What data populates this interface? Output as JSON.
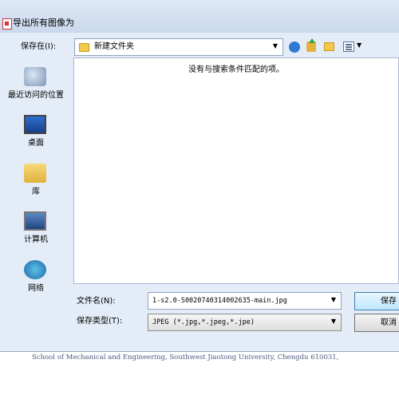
{
  "window": {
    "title": "导出所有图像为"
  },
  "toolbar": {
    "look_in_label": "保存在(I):",
    "look_in_value": "新建文件夹"
  },
  "places": [
    {
      "label": "最近访问的位置",
      "icon": "recent-places-icon"
    },
    {
      "label": "桌面",
      "icon": "desktop-icon"
    },
    {
      "label": "库",
      "icon": "library-icon"
    },
    {
      "label": "计算机",
      "icon": "computer-icon"
    },
    {
      "label": "网络",
      "icon": "network-icon"
    }
  ],
  "file_list": {
    "empty_message": "没有与搜索条件匹配的项。"
  },
  "form": {
    "filename_label": "文件名(N):",
    "filename_value": "1-s2.0-S0020740314002635-main.jpg",
    "filetype_label": "保存类型(T):",
    "filetype_value": "JPEG (*.jpg,*.jpeg,*.jpe)"
  },
  "buttons": {
    "save": "保存",
    "cancel": "取消"
  },
  "background_text": "School of Mechanical and Engineering, Southwest Jiaotong University, Chengdu 610031,"
}
